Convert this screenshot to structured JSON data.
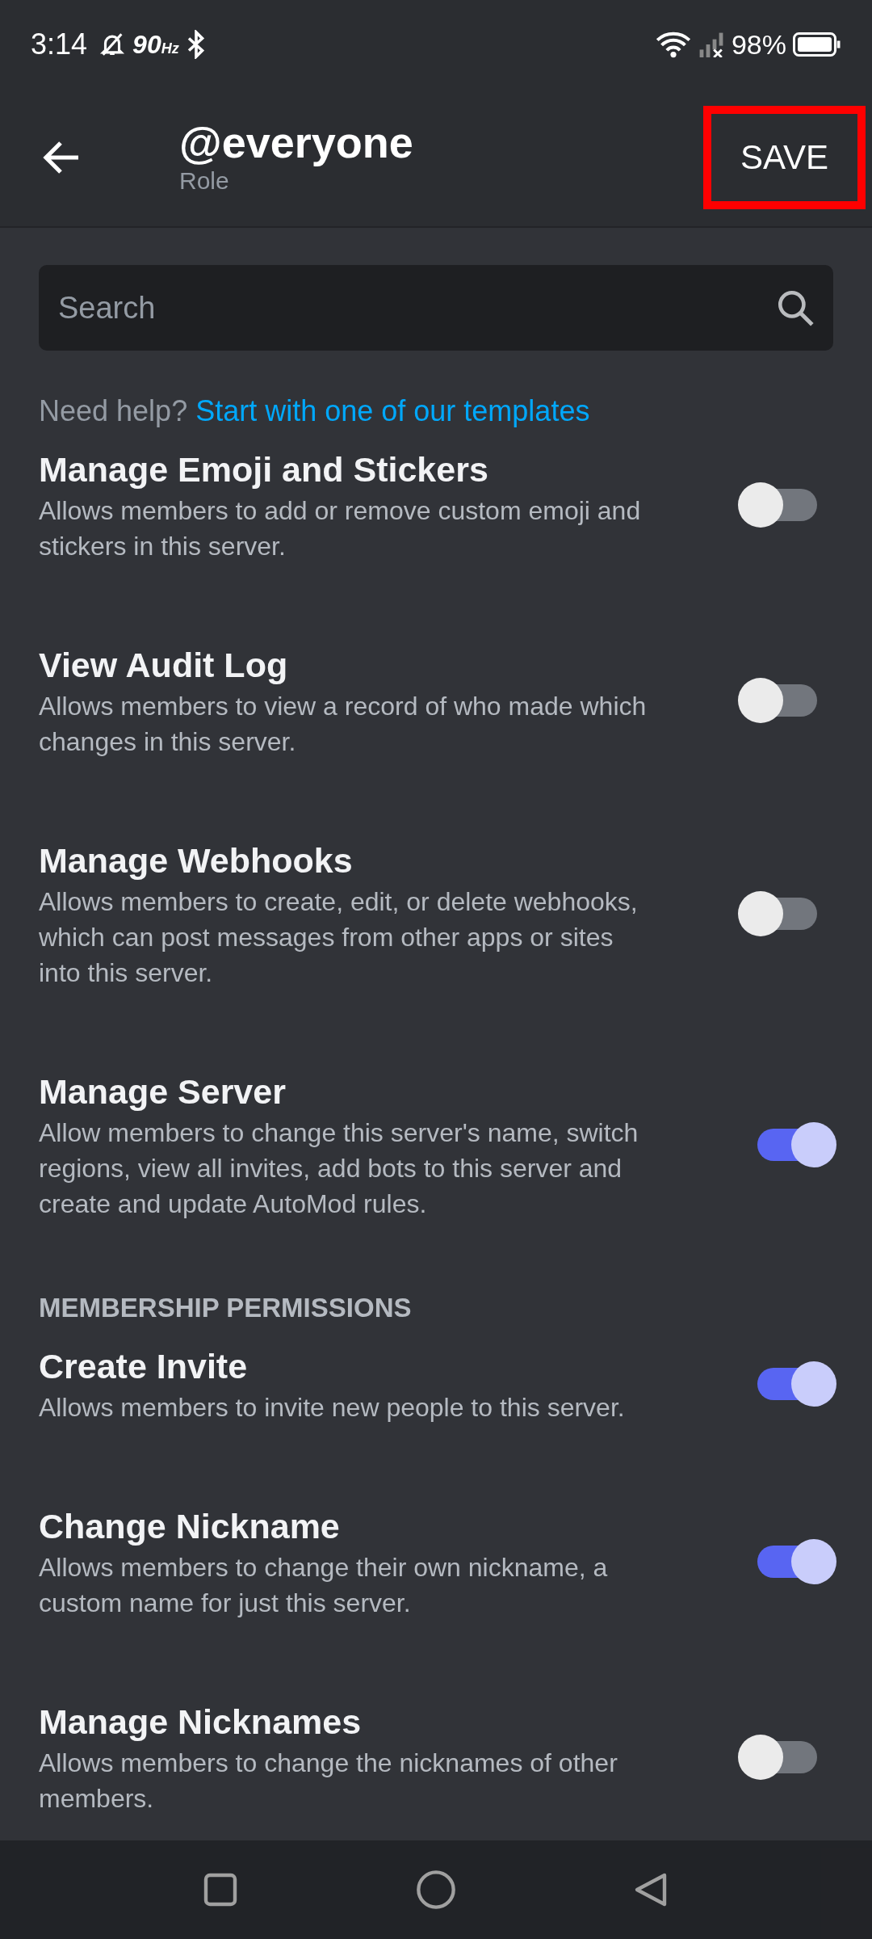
{
  "status_bar": {
    "time": "3:14",
    "refresh": "90",
    "refresh_unit": "Hz",
    "battery": "98%"
  },
  "header": {
    "title": "@everyone",
    "subtitle": "Role",
    "save": {
      "label": "SAVE",
      "highlighted": true
    }
  },
  "search": {
    "placeholder": "Search"
  },
  "help": {
    "text": "Need help?",
    "link": "Start with one of our templates"
  },
  "items": [
    {
      "kind": "permission",
      "title": "Manage Emoji and Stickers",
      "description": "Allows members to add or remove custom emoji and stickers in this server.",
      "on": false
    },
    {
      "kind": "permission",
      "title": "View Audit Log",
      "description": "Allows members to view a record of who made which changes in this server.",
      "on": false
    },
    {
      "kind": "permission",
      "title": "Manage Webhooks",
      "description": "Allows members to create, edit, or delete webhooks, which can post messages from other apps or sites into this server.",
      "on": false
    },
    {
      "kind": "permission",
      "title": "Manage Server",
      "description": "Allow members to change this server's name, switch regions, view all invites, add bots to this server and create and update AutoMod rules.",
      "on": true
    },
    {
      "kind": "section",
      "title": "MEMBERSHIP PERMISSIONS"
    },
    {
      "kind": "permission",
      "title": "Create Invite",
      "description": "Allows members to invite new people to this server.",
      "on": true
    },
    {
      "kind": "permission",
      "title": "Change Nickname",
      "description": "Allows members to change their own nickname, a custom name for just this server.",
      "on": true
    },
    {
      "kind": "permission",
      "title": "Manage Nicknames",
      "description": "Allows members to change the nicknames of other members.",
      "on": false
    }
  ]
}
